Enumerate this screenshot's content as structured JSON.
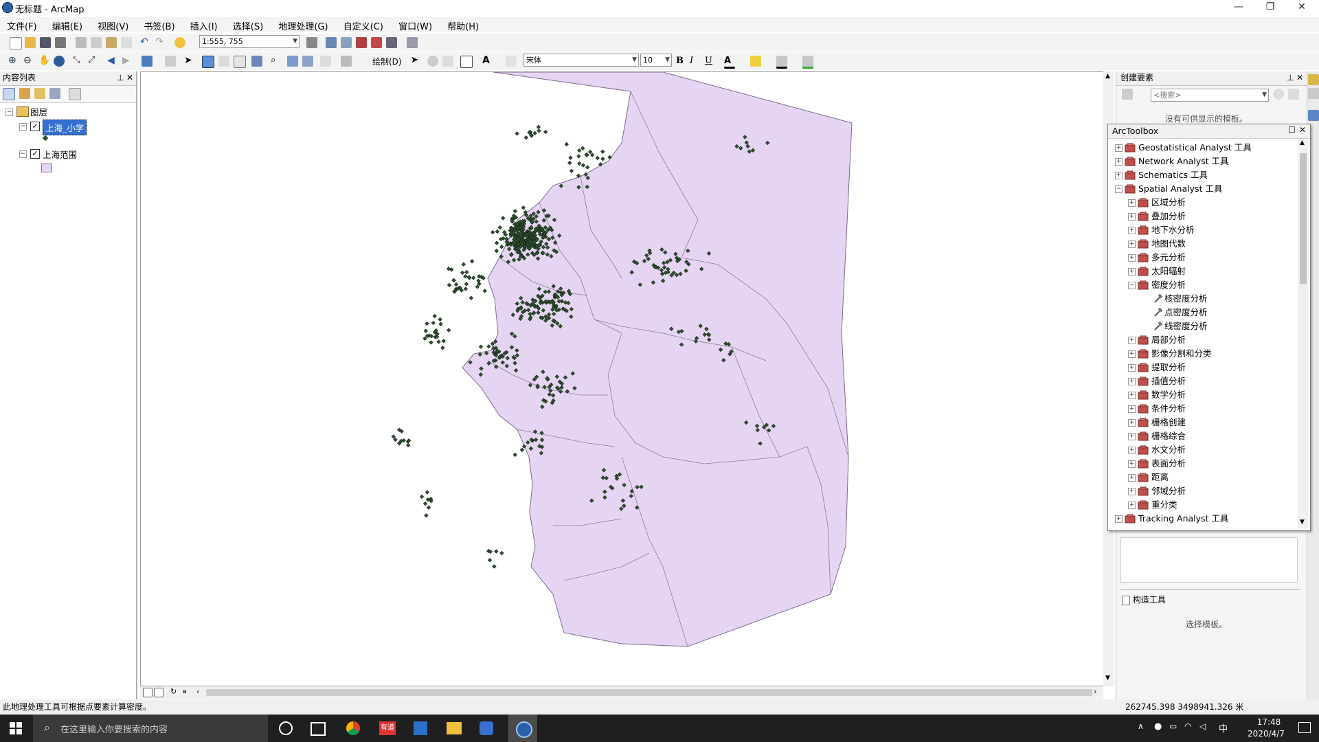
{
  "window": {
    "title": "无标题 - ArcMap",
    "min": "—",
    "max": "❐",
    "close": "✕"
  },
  "menu": [
    "文件(F)",
    "编辑(E)",
    "视图(V)",
    "书签(B)",
    "插入(I)",
    "选择(S)",
    "地理处理(G)",
    "自定义(C)",
    "窗口(W)",
    "帮助(H)"
  ],
  "toolbar": {
    "scale": "1:555, 755",
    "draw_label": "绘制(D)",
    "font": "宋体",
    "font_size": "10",
    "bold": "B",
    "italic": "I",
    "underline": "U",
    "text_tool": "A"
  },
  "toc": {
    "title": "内容列表",
    "root": "图层",
    "layers": [
      {
        "name": "上海_小学",
        "checked": true,
        "selected": true
      },
      {
        "name": "上海范围",
        "checked": true,
        "selected": false
      }
    ]
  },
  "create_features": {
    "title": "创建要素",
    "search_placeholder": "<搜索>",
    "empty": "没有可供显示的模板。",
    "construct_title": "构造工具",
    "construct_hint": "选择模板。"
  },
  "arctoolbox": {
    "title": "ArcToolbox",
    "items": [
      {
        "label": "Geostatistical Analyst 工具",
        "level": 0,
        "kind": "toolbox",
        "exp": "+"
      },
      {
        "label": "Network Analyst 工具",
        "level": 0,
        "kind": "toolbox",
        "exp": "+"
      },
      {
        "label": "Schematics 工具",
        "level": 0,
        "kind": "toolbox",
        "exp": "+"
      },
      {
        "label": "Spatial Analyst 工具",
        "level": 0,
        "kind": "toolbox",
        "exp": "−"
      },
      {
        "label": "区域分析",
        "level": 1,
        "kind": "toolset",
        "exp": "+"
      },
      {
        "label": "叠加分析",
        "level": 1,
        "kind": "toolset",
        "exp": "+"
      },
      {
        "label": "地下水分析",
        "level": 1,
        "kind": "toolset",
        "exp": "+"
      },
      {
        "label": "地图代数",
        "level": 1,
        "kind": "toolset",
        "exp": "+"
      },
      {
        "label": "多元分析",
        "level": 1,
        "kind": "toolset",
        "exp": "+"
      },
      {
        "label": "太阳辐射",
        "level": 1,
        "kind": "toolset",
        "exp": "+"
      },
      {
        "label": "密度分析",
        "level": 1,
        "kind": "toolset",
        "exp": "−"
      },
      {
        "label": "核密度分析",
        "level": 2,
        "kind": "tool",
        "exp": ""
      },
      {
        "label": "点密度分析",
        "level": 2,
        "kind": "tool",
        "exp": ""
      },
      {
        "label": "线密度分析",
        "level": 2,
        "kind": "tool",
        "exp": ""
      },
      {
        "label": "局部分析",
        "level": 1,
        "kind": "toolset",
        "exp": "+"
      },
      {
        "label": "影像分割和分类",
        "level": 1,
        "kind": "toolset",
        "exp": "+"
      },
      {
        "label": "提取分析",
        "level": 1,
        "kind": "toolset",
        "exp": "+"
      },
      {
        "label": "插值分析",
        "level": 1,
        "kind": "toolset",
        "exp": "+"
      },
      {
        "label": "数学分析",
        "level": 1,
        "kind": "toolset",
        "exp": "+"
      },
      {
        "label": "条件分析",
        "level": 1,
        "kind": "toolset",
        "exp": "+"
      },
      {
        "label": "栅格创建",
        "level": 1,
        "kind": "toolset",
        "exp": "+"
      },
      {
        "label": "栅格综合",
        "level": 1,
        "kind": "toolset",
        "exp": "+"
      },
      {
        "label": "水文分析",
        "level": 1,
        "kind": "toolset",
        "exp": "+"
      },
      {
        "label": "表面分析",
        "level": 1,
        "kind": "toolset",
        "exp": "+"
      },
      {
        "label": "距离",
        "level": 1,
        "kind": "toolset",
        "exp": "+"
      },
      {
        "label": "邻域分析",
        "level": 1,
        "kind": "toolset",
        "exp": "+"
      },
      {
        "label": "重分类",
        "level": 1,
        "kind": "toolset",
        "exp": "+"
      },
      {
        "label": "Tracking Analyst 工具",
        "level": 0,
        "kind": "toolbox",
        "exp": "+"
      }
    ]
  },
  "status": {
    "message": "此地理处理工具可根据点要素计算密度。",
    "coords": "262745.398  3498941.326 米"
  },
  "taskbar": {
    "search_placeholder": "在这里输入你要搜索的内容",
    "time": "17:48",
    "date": "2020/4/7",
    "ime": "中"
  },
  "colors": {
    "polygon_fill": "#e6d5f2",
    "polygon_stroke": "#7a6a8a",
    "point_fill": "#2f4f2f",
    "taskbar": "#1f1f1f"
  }
}
